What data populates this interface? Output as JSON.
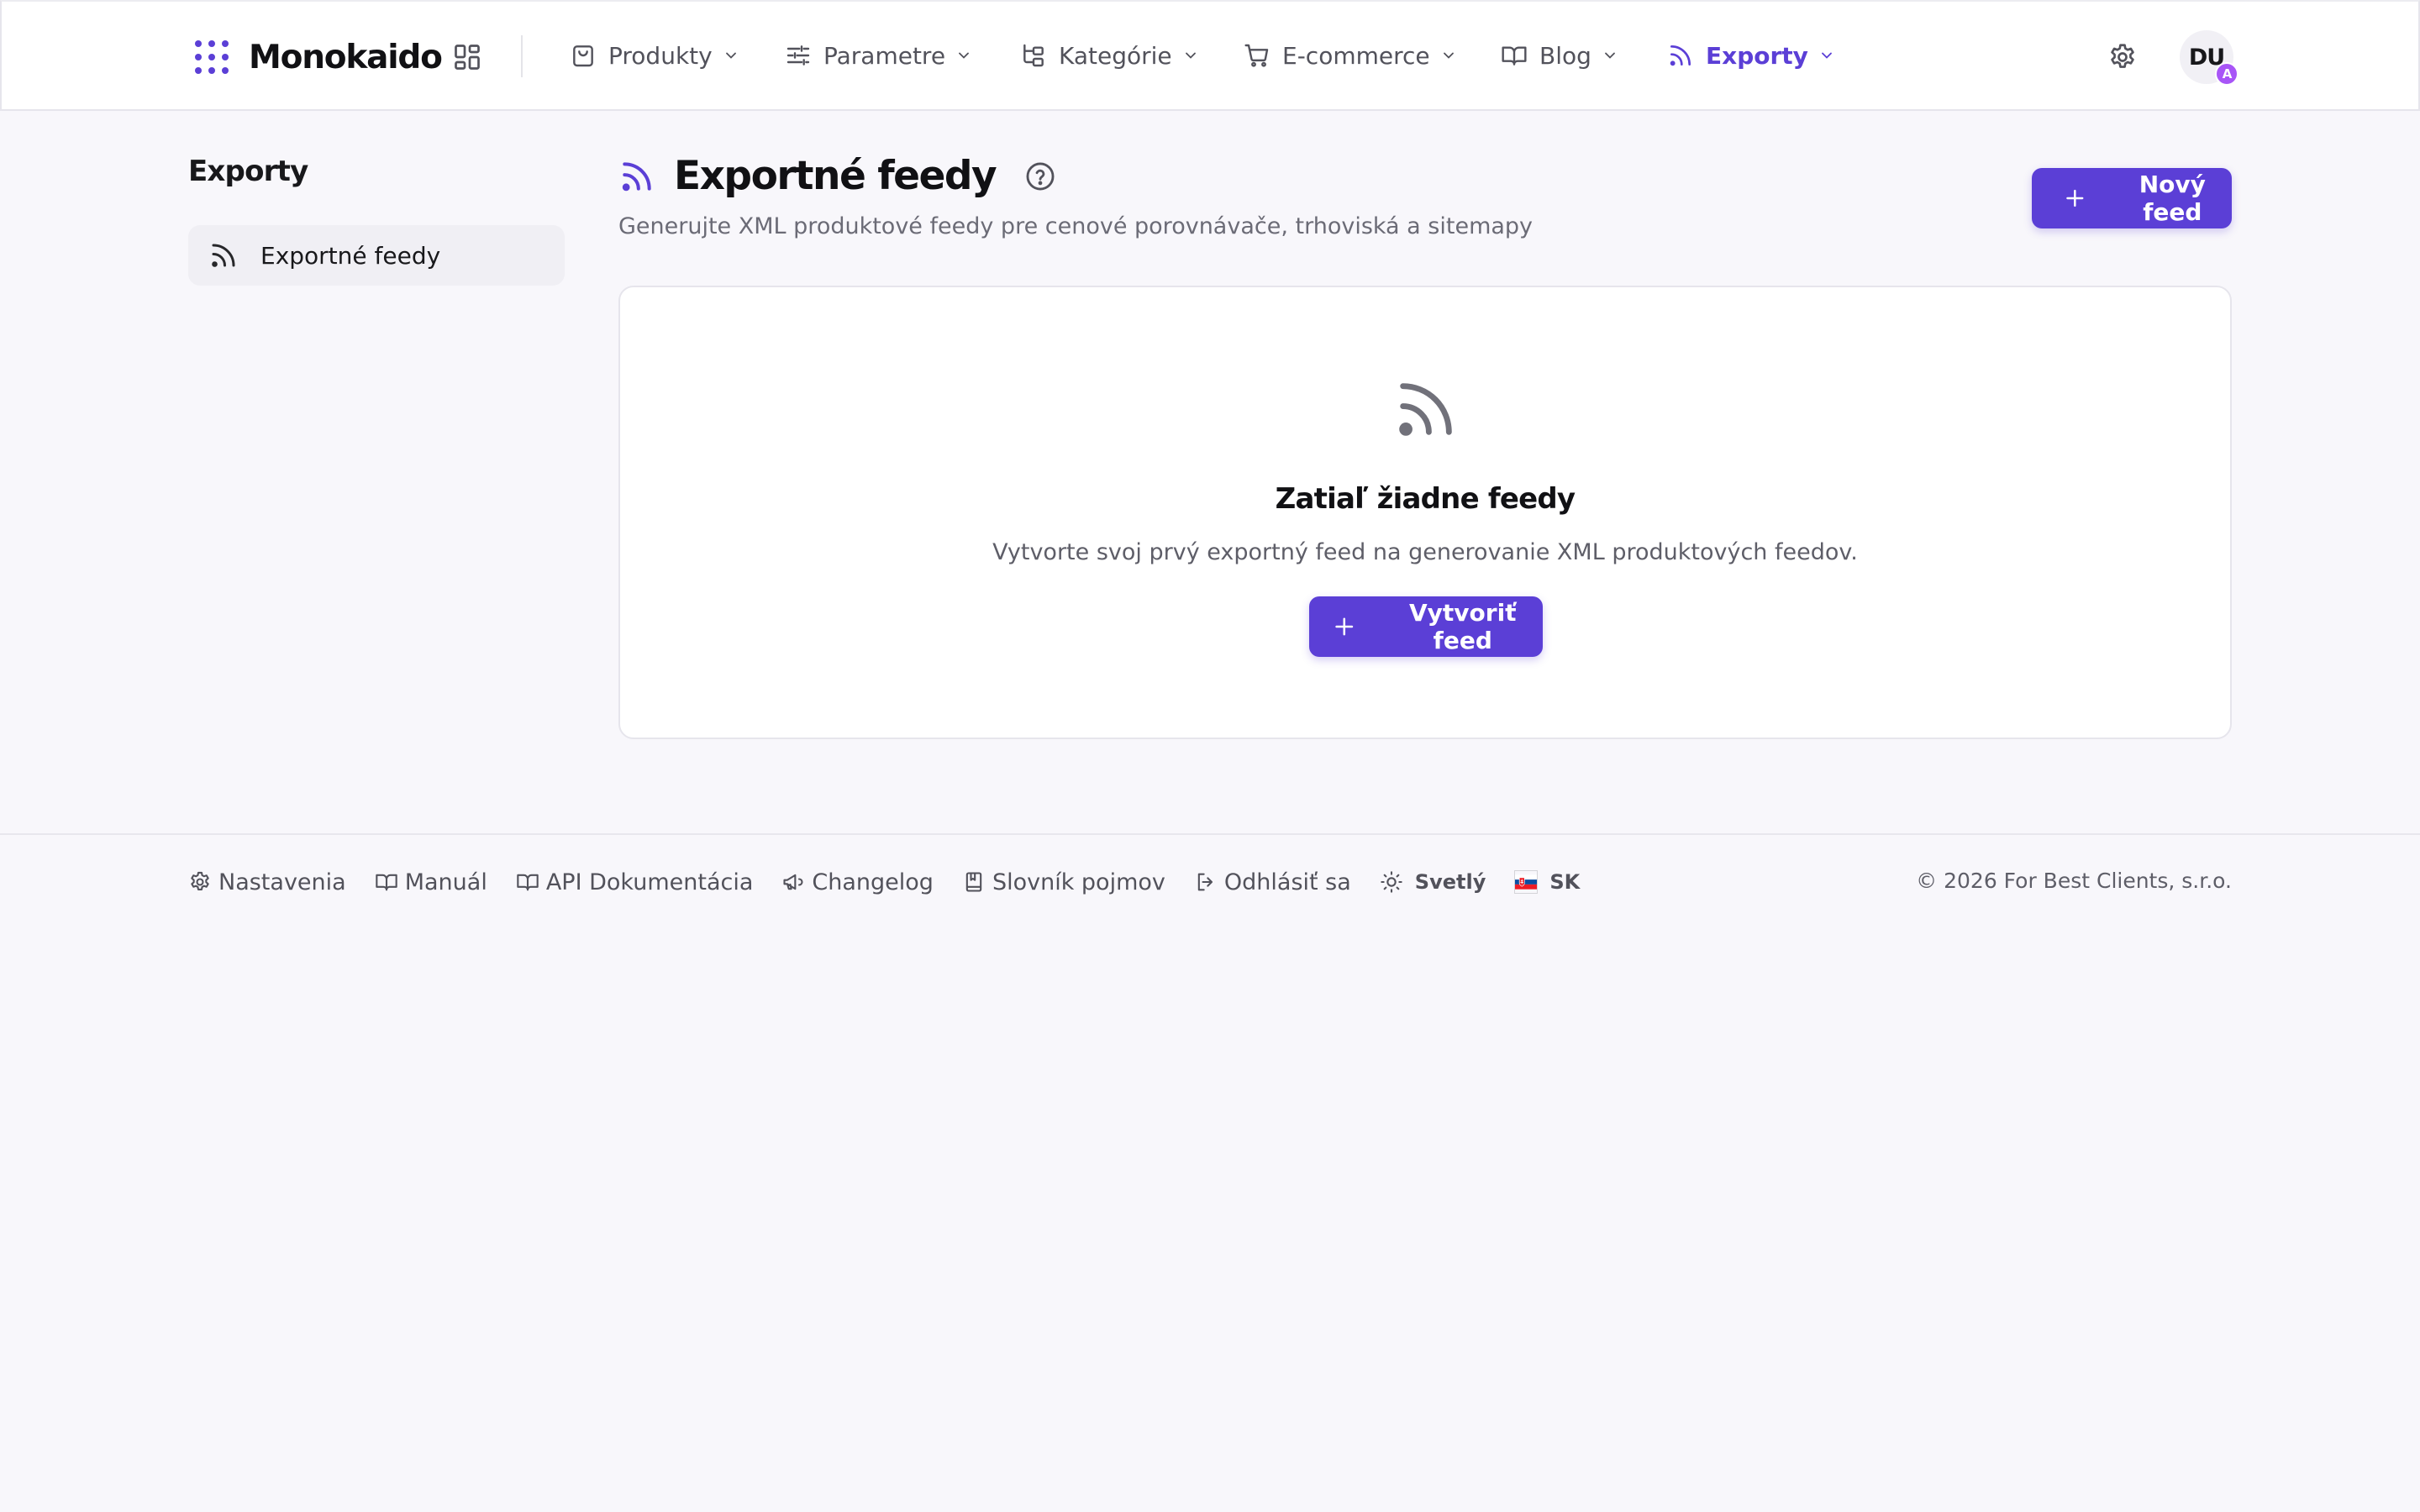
{
  "app": {
    "name": "Monokaido",
    "avatar_initials": "DU",
    "avatar_badge": "A"
  },
  "colors": {
    "accent": "#5b3fd6",
    "badge": "#a855f7",
    "background": "#f8f7fb"
  },
  "nav": {
    "items": [
      {
        "label": "Produkty",
        "icon": "shopping-bag-icon",
        "active": false
      },
      {
        "label": "Parametre",
        "icon": "sliders-icon",
        "active": false
      },
      {
        "label": "Kategórie",
        "icon": "category-tree-icon",
        "active": false
      },
      {
        "label": "E-commerce",
        "icon": "cart-icon",
        "active": false
      },
      {
        "label": "Blog",
        "icon": "book-icon",
        "active": false
      },
      {
        "label": "Exporty",
        "icon": "rss-icon",
        "active": true
      }
    ]
  },
  "sidebar": {
    "title": "Exporty",
    "items": [
      {
        "label": "Exportné feedy",
        "icon": "rss-icon",
        "active": true
      }
    ]
  },
  "page": {
    "title": "Exportné feedy",
    "subtitle": "Generujte XML produktové feedy pre cenové porovnávače, trhoviská a sitemapy",
    "new_button": "Nový feed"
  },
  "empty_state": {
    "title": "Zatiaľ žiadne feedy",
    "text": "Vytvorte svoj prvý exportný feed na generovanie XML produktových feedov.",
    "button": "Vytvoriť feed"
  },
  "footer": {
    "links": [
      {
        "label": "Nastavenia",
        "icon": "gear-icon"
      },
      {
        "label": "Manuál",
        "icon": "book-icon"
      },
      {
        "label": "API Dokumentácia",
        "icon": "book-icon"
      },
      {
        "label": "Changelog",
        "icon": "megaphone-icon"
      },
      {
        "label": "Slovník pojmov",
        "icon": "bookmark-book-icon"
      },
      {
        "label": "Odhlásiť sa",
        "icon": "logout-icon"
      }
    ],
    "theme_label": "Svetlý",
    "language": "SK",
    "copyright": "© 2026 For Best Clients, s.r.o."
  }
}
